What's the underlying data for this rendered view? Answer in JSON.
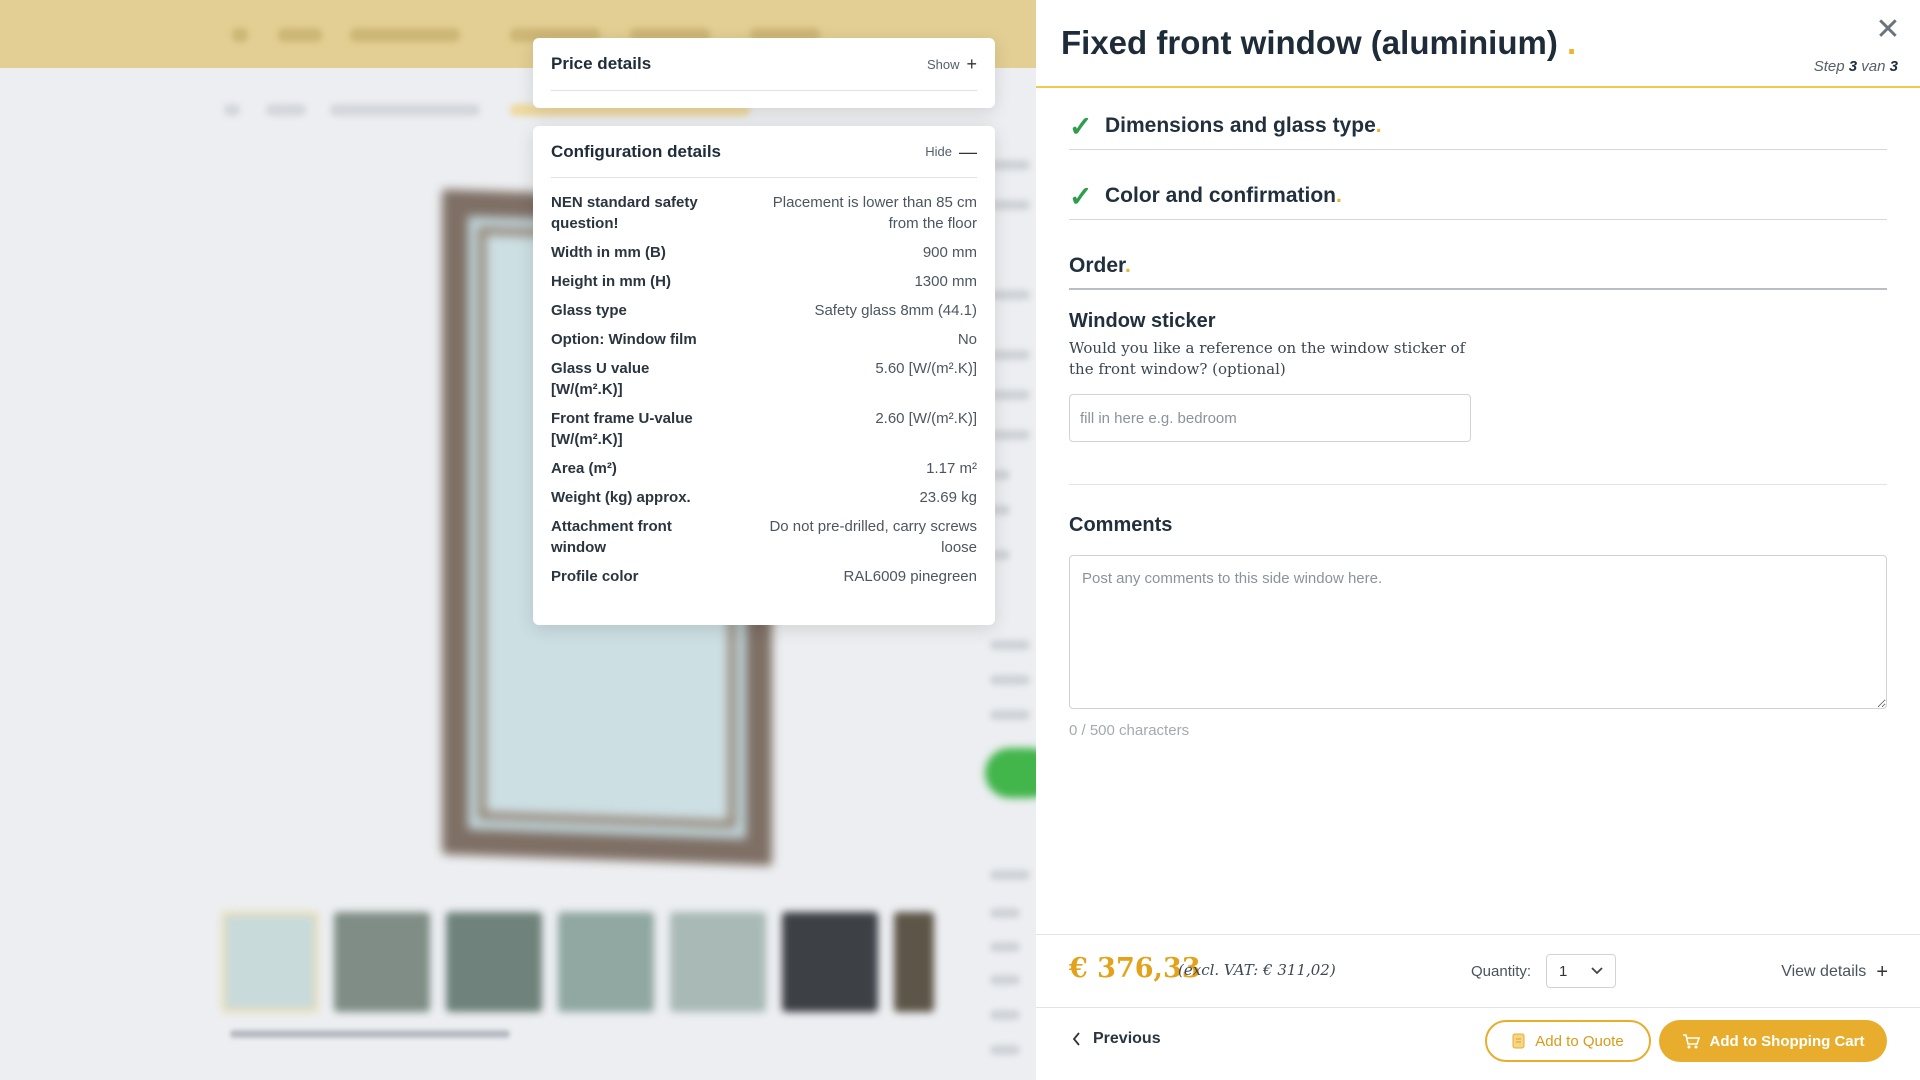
{
  "price_card": {
    "title": "Price details",
    "toggle_label": "Show",
    "toggle_symbol": "+"
  },
  "config_card": {
    "title": "Configuration details",
    "toggle_label": "Hide",
    "toggle_symbol": "—",
    "rows": [
      {
        "label": "NEN standard safety question!",
        "value": "Placement is lower than 85 cm from the floor"
      },
      {
        "label": "Width in mm (B)",
        "value": "900 mm"
      },
      {
        "label": "Height in mm (H)",
        "value": "1300 mm"
      },
      {
        "label": "Glass type",
        "value": "Safety glass 8mm (44.1)"
      },
      {
        "label": "Option: Window film",
        "value": "No"
      },
      {
        "label": "Glass U value [W/(m².K)]",
        "value": "5.60 [W/(m².K)]"
      },
      {
        "label": "Front frame U-value [W/(m².K)]",
        "value": "2.60 [W/(m².K)]"
      },
      {
        "label": "Area (m²)",
        "value": "1.17 m²"
      },
      {
        "label": "Weight (kg) approx.",
        "value": "23.69 kg"
      },
      {
        "label": "Attachment front window",
        "value": "Do not pre-drilled, carry screws loose"
      },
      {
        "label": "Profile color",
        "value": "RAL6009 pinegreen"
      }
    ]
  },
  "panel": {
    "title": "Fixed front window (aluminium)",
    "title_dot": ".",
    "close_symbol": "✕",
    "step_prefix": "Step",
    "step_current": "3",
    "step_middle": "van",
    "step_total": "3",
    "sections": {
      "dimensions": {
        "check": "✓",
        "title": "Dimensions and glass type",
        "dot": "."
      },
      "color": {
        "check": "✓",
        "title": "Color and confirmation",
        "dot": "."
      },
      "order": {
        "title": "Order",
        "dot": "."
      }
    },
    "sticker": {
      "label": "Window sticker",
      "description": "Would you like a reference on the window sticker of the front window? (optional)",
      "placeholder": "fill in here e.g. bedroom",
      "value": ""
    },
    "comments": {
      "label": "Comments",
      "placeholder": "Post any comments to this side window here.",
      "char_count": "0 / 500 characters"
    },
    "footer": {
      "price": "€ 376,33",
      "price_excl_vat": "(excl. VAT: € 311,02)",
      "quantity_label": "Quantity:",
      "quantity_value": "1",
      "view_details": "View details",
      "view_details_symbol": "+",
      "previous": "Previous",
      "add_to_quote": "Add to Quote",
      "add_to_cart": "Add to Shopping Cart"
    }
  },
  "colors": {
    "accent": "#e8ad2d",
    "check_green": "#2e9d4e",
    "header_rule": "#f0c94a"
  }
}
